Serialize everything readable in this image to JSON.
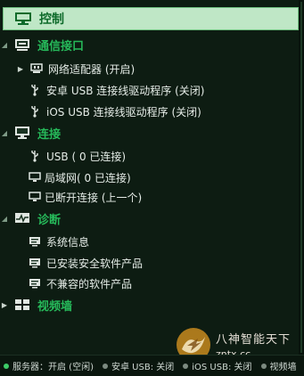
{
  "header": {
    "title": "控制"
  },
  "tree": {
    "comm": {
      "label": "通信接口",
      "items": {
        "adapter": "网络适配器 (开启)",
        "android_usb": "安卓 USB 连接线驱动程序 (关闭)",
        "ios_usb": "iOS USB 连接线驱动程序 (关闭)"
      }
    },
    "connect": {
      "label": "连接",
      "items": {
        "usb": "USB ( 0 已连接)",
        "lan": "局域网( 0 已连接)",
        "disconnected": "已断开连接 (上一个)"
      }
    },
    "diag": {
      "label": "诊断",
      "items": {
        "sysinfo": "系统信息",
        "security": "已安装安全软件产品",
        "incompatible": "不兼容的软件产品"
      }
    },
    "videowall": {
      "label": "视频墙"
    }
  },
  "status_bar": {
    "server": "服务器：开启 (空闲)",
    "android_usb": "安卓 USB: 关闭",
    "ios_usb": "iOS USB: 关闭",
    "videowall": "视频墙"
  },
  "watermark": {
    "line1": "八神智能天下",
    "line2": "zntx.cc"
  },
  "colors": {
    "section_text": "#26b95a",
    "header_bg": "#bfe7c6",
    "header_text": "#0e6b2b",
    "background": "#0d1c12"
  }
}
